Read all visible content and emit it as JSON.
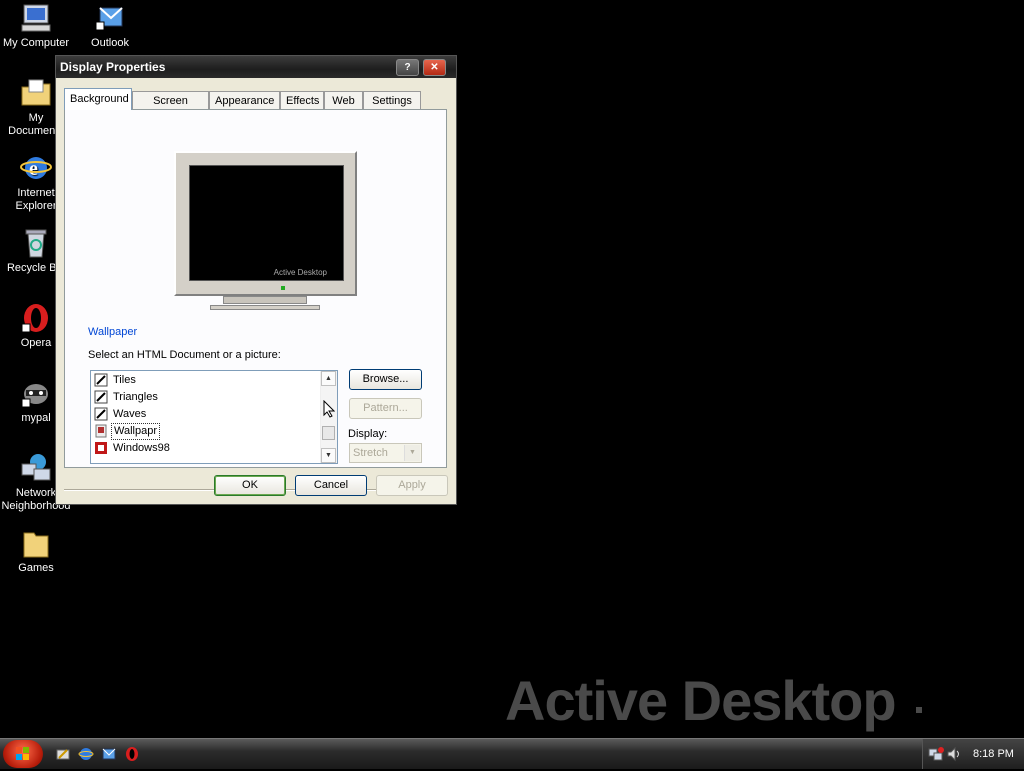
{
  "desktop": {
    "icons": [
      {
        "label": "My Computer"
      },
      {
        "label": "Outlook"
      },
      {
        "label": "My Documents"
      },
      {
        "label": "Internet Explorer"
      },
      {
        "label": "Recycle Bin"
      },
      {
        "label": "Opera"
      },
      {
        "label": "mypal"
      },
      {
        "label": "Network Neighborhood"
      },
      {
        "label": "Games"
      }
    ],
    "watermark": "Active Desktop"
  },
  "dialog": {
    "title": "Display Properties",
    "help_glyph": "?",
    "close_glyph": "✕",
    "tabs": [
      {
        "label": "Background",
        "active": true
      },
      {
        "label": "Screen Saver"
      },
      {
        "label": "Appearance"
      },
      {
        "label": "Effects"
      },
      {
        "label": "Web"
      },
      {
        "label": "Settings"
      }
    ],
    "preview_text": "Active Desktop",
    "wallpaper_heading": "Wallpaper",
    "select_label": "Select an HTML Document or a picture:",
    "wallpaper_list": [
      {
        "label": "Tiles"
      },
      {
        "label": "Triangles"
      },
      {
        "label": "Waves"
      },
      {
        "label": "Wallpapr",
        "selected": true
      },
      {
        "label": "Windows98"
      }
    ],
    "browse_label": "Browse...",
    "pattern_label": "Pattern...",
    "display_label": "Display:",
    "display_value": "Stretch",
    "ok_label": "OK",
    "cancel_label": "Cancel",
    "apply_label": "Apply"
  },
  "taskbar": {
    "clock": "8:18 PM"
  },
  "colors": {
    "accent_blue": "#0046d5",
    "start_red": "#d8301a",
    "titlebar": "#2a2a2a"
  }
}
